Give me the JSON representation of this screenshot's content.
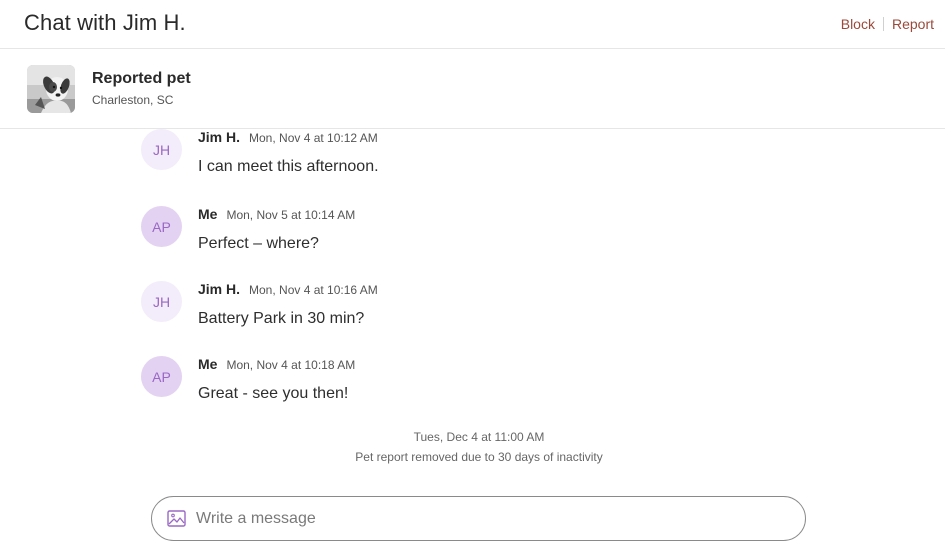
{
  "header": {
    "title": "Chat with Jim H.",
    "block_label": "Block",
    "report_label": "Report",
    "accent_color": "#9a4a3a"
  },
  "pet": {
    "thumbnail_icon": "dog-photo",
    "name": "Reported pet",
    "location": "Charleston, SC"
  },
  "messages": [
    {
      "initials": "JH",
      "sender": "Jim H.",
      "time": "Mon, Nov 4 at 10:12 AM",
      "text": "I can meet this afternoon."
    },
    {
      "initials": "AP",
      "sender": "Me",
      "time": "Mon, Nov 5 at 10:14 AM",
      "text": "Perfect – where?"
    },
    {
      "initials": "JH",
      "sender": "Jim H.",
      "time": "Mon, Nov 4 at 10:16 AM",
      "text": "Battery Park in 30 min?"
    },
    {
      "initials": "AP",
      "sender": "Me",
      "time": "Mon, Nov 4 at 10:18 AM",
      "text": "Great - see you then!"
    }
  ],
  "system_notice": {
    "time": "Tues, Dec 4 at 11:00 AM",
    "text": "Pet report removed due to 30 days of inactivity"
  },
  "composer": {
    "icon": "image-icon",
    "placeholder": "Write a message",
    "value": ""
  }
}
